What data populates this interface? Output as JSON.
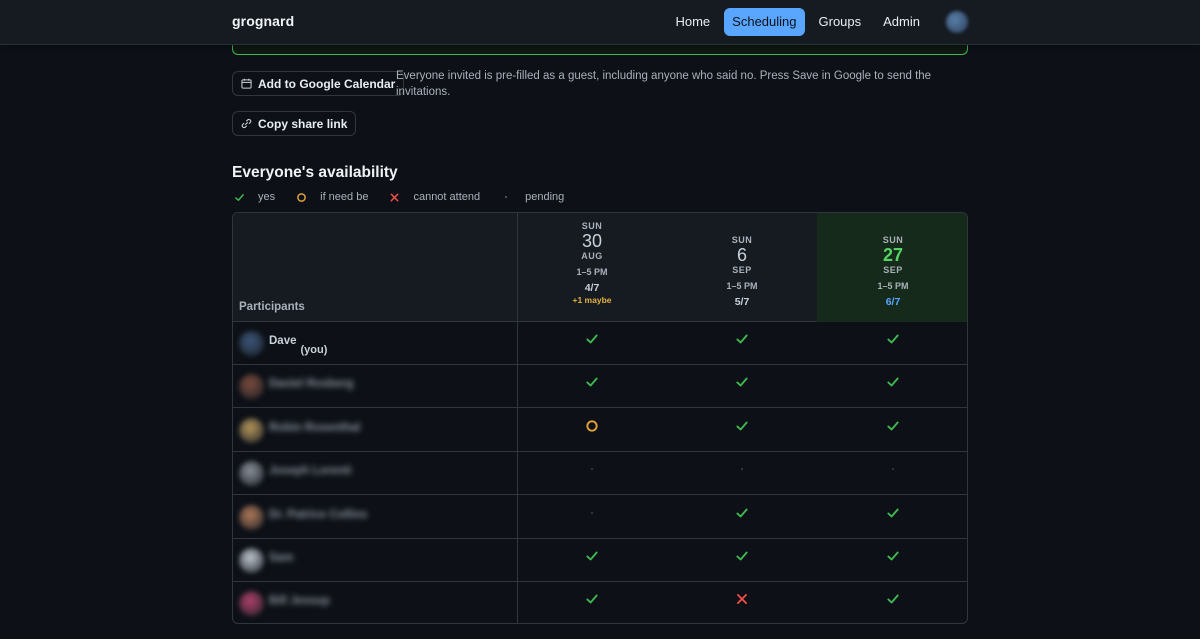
{
  "brand": "grognard",
  "nav": {
    "items": [
      {
        "label": "Home",
        "active": false
      },
      {
        "label": "Scheduling",
        "active": true
      },
      {
        "label": "Groups",
        "active": false
      },
      {
        "label": "Admin",
        "active": false
      }
    ]
  },
  "actions": {
    "gcal_label": "Add to Google Calendar",
    "gcal_hint": "Everyone invited is pre-filled as a guest, including anyone who said no. Press Save in Google to send the invitations.",
    "share_label": "Copy share link"
  },
  "availability": {
    "title": "Everyone's availability",
    "legend": {
      "yes": "yes",
      "maybe": "if need be",
      "no": "cannot attend",
      "pending": "pending"
    },
    "participants_header": "Participants",
    "dates": [
      {
        "dow": "SUN",
        "day": "30",
        "month": "AUG",
        "time": "1–5 PM",
        "count": "4/7",
        "maybe": "+1 maybe",
        "best": false
      },
      {
        "dow": "SUN",
        "day": "6",
        "month": "SEP",
        "time": "1–5 PM",
        "count": "5/7",
        "maybe": "",
        "best": false
      },
      {
        "dow": "SUN",
        "day": "27",
        "month": "SEP",
        "time": "1–5 PM",
        "count": "6/7",
        "maybe": "",
        "best": true
      }
    ],
    "participants": [
      {
        "name": "Dave",
        "you_tag": "(you)",
        "blurred": false,
        "avatar_color": "#3b5578",
        "responses": [
          "yes",
          "yes",
          "yes"
        ]
      },
      {
        "name": "Daniel Rosberg",
        "you_tag": "",
        "blurred": true,
        "avatar_color": "#7a4a3a",
        "responses": [
          "yes",
          "yes",
          "yes"
        ]
      },
      {
        "name": "Robin Rosenthal",
        "you_tag": "",
        "blurred": true,
        "avatar_color": "#b5955a",
        "responses": [
          "maybe",
          "yes",
          "yes"
        ]
      },
      {
        "name": "Joseph Lorenti",
        "you_tag": "",
        "blurred": true,
        "avatar_color": "#8a9098",
        "responses": [
          "pending",
          "pending",
          "pending"
        ]
      },
      {
        "name": "Dr. Patrice Collins",
        "you_tag": "",
        "blurred": true,
        "avatar_color": "#b07858",
        "responses": [
          "pending",
          "yes",
          "yes"
        ]
      },
      {
        "name": "Sam",
        "you_tag": "",
        "blurred": true,
        "avatar_color": "#c0c6cf",
        "responses": [
          "yes",
          "yes",
          "yes"
        ]
      },
      {
        "name": "Bill Jessup",
        "you_tag": "",
        "blurred": true,
        "avatar_color": "#b0406a",
        "responses": [
          "yes",
          "no",
          "yes"
        ]
      }
    ]
  },
  "colors": {
    "yes": "#3fb950",
    "maybe": "#e3a13b",
    "no": "#f85149",
    "pending": "#3a414a",
    "accent": "#58a6ff"
  }
}
